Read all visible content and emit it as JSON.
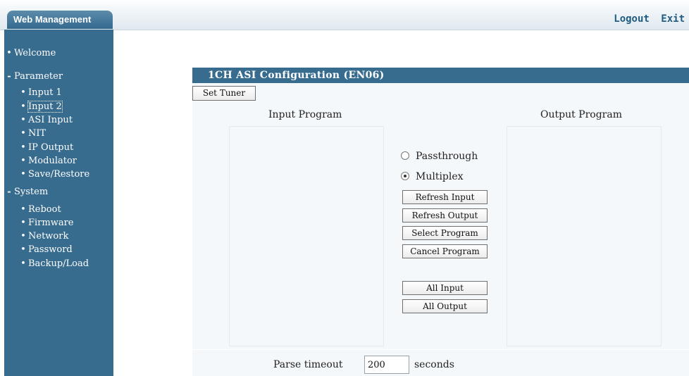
{
  "header": {
    "brand": "Web Management",
    "logout": "Logout",
    "exit": "Exit"
  },
  "sidebar": {
    "items": [
      {
        "marker": "•",
        "label": "Welcome"
      },
      {
        "marker": "-",
        "label": "Parameter"
      },
      {
        "marker": "•",
        "label": "Input 1"
      },
      {
        "marker": "•",
        "label": "Input 2"
      },
      {
        "marker": "•",
        "label": "ASI Input"
      },
      {
        "marker": "•",
        "label": "NIT"
      },
      {
        "marker": "•",
        "label": "IP Output"
      },
      {
        "marker": "•",
        "label": "Modulator"
      },
      {
        "marker": "•",
        "label": "Save/Restore"
      },
      {
        "marker": "-",
        "label": "System"
      },
      {
        "marker": "•",
        "label": "Reboot"
      },
      {
        "marker": "•",
        "label": "Firmware"
      },
      {
        "marker": "•",
        "label": "Network"
      },
      {
        "marker": "•",
        "label": "Password"
      },
      {
        "marker": "•",
        "label": "Backup/Load"
      }
    ],
    "active": "Input 2"
  },
  "panel": {
    "title": "1CH ASI Configuration (EN06)",
    "set_tuner": "Set Tuner",
    "input_program": "Input Program",
    "output_program": "Output Program",
    "mode": {
      "passthrough": "Passthrough",
      "multiplex": "Multiplex",
      "selected": "Multiplex"
    },
    "buttons": {
      "refresh_input": "Refresh Input",
      "refresh_output": "Refresh Output",
      "select_program": "Select Program",
      "cancel_program": "Cancel Program",
      "all_input": "All Input",
      "all_output": "All Output"
    },
    "parse_timeout": {
      "label": "Parse timeout",
      "value": "200",
      "unit": "seconds"
    }
  }
}
